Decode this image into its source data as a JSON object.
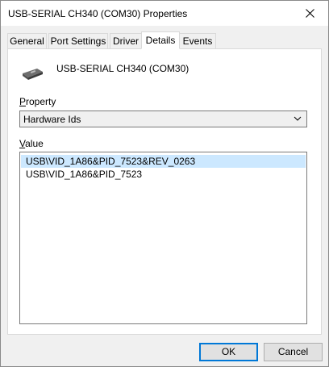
{
  "window": {
    "title": "USB-SERIAL CH340 (COM30) Properties"
  },
  "tabs": [
    {
      "label": "General"
    },
    {
      "label": "Port Settings"
    },
    {
      "label": "Driver"
    },
    {
      "label": "Details"
    },
    {
      "label": "Events"
    }
  ],
  "active_tab": "Details",
  "device": {
    "name": "USB-SERIAL CH340 (COM30)",
    "icon": "serial-port-icon"
  },
  "property": {
    "label": "Property",
    "selected": "Hardware Ids"
  },
  "value": {
    "label": "Value",
    "items": [
      {
        "text": "USB\\VID_1A86&PID_7523&REV_0263",
        "selected": true
      },
      {
        "text": "USB\\VID_1A86&PID_7523",
        "selected": false
      }
    ]
  },
  "buttons": {
    "ok": "OK",
    "cancel": "Cancel"
  },
  "colors": {
    "selection": "#cce8ff",
    "accent": "#0078d7"
  }
}
